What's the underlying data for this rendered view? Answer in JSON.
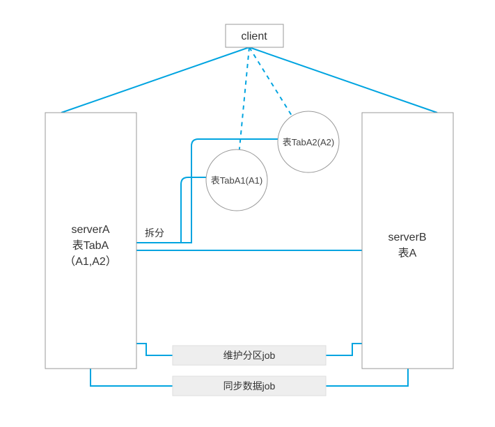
{
  "client": {
    "label": "client"
  },
  "serverA": {
    "line1": "serverA",
    "line2": "表TabA",
    "line3": "（A1,A2）"
  },
  "serverB": {
    "line1": "serverB",
    "line2": "表A"
  },
  "split": {
    "label": "拆分"
  },
  "tabA1": {
    "label": "表TabA1(A1)"
  },
  "tabA2": {
    "label": "表TabA2(A2)"
  },
  "job1": {
    "label": "维护分区job"
  },
  "job2": {
    "label": "同步数据job"
  }
}
